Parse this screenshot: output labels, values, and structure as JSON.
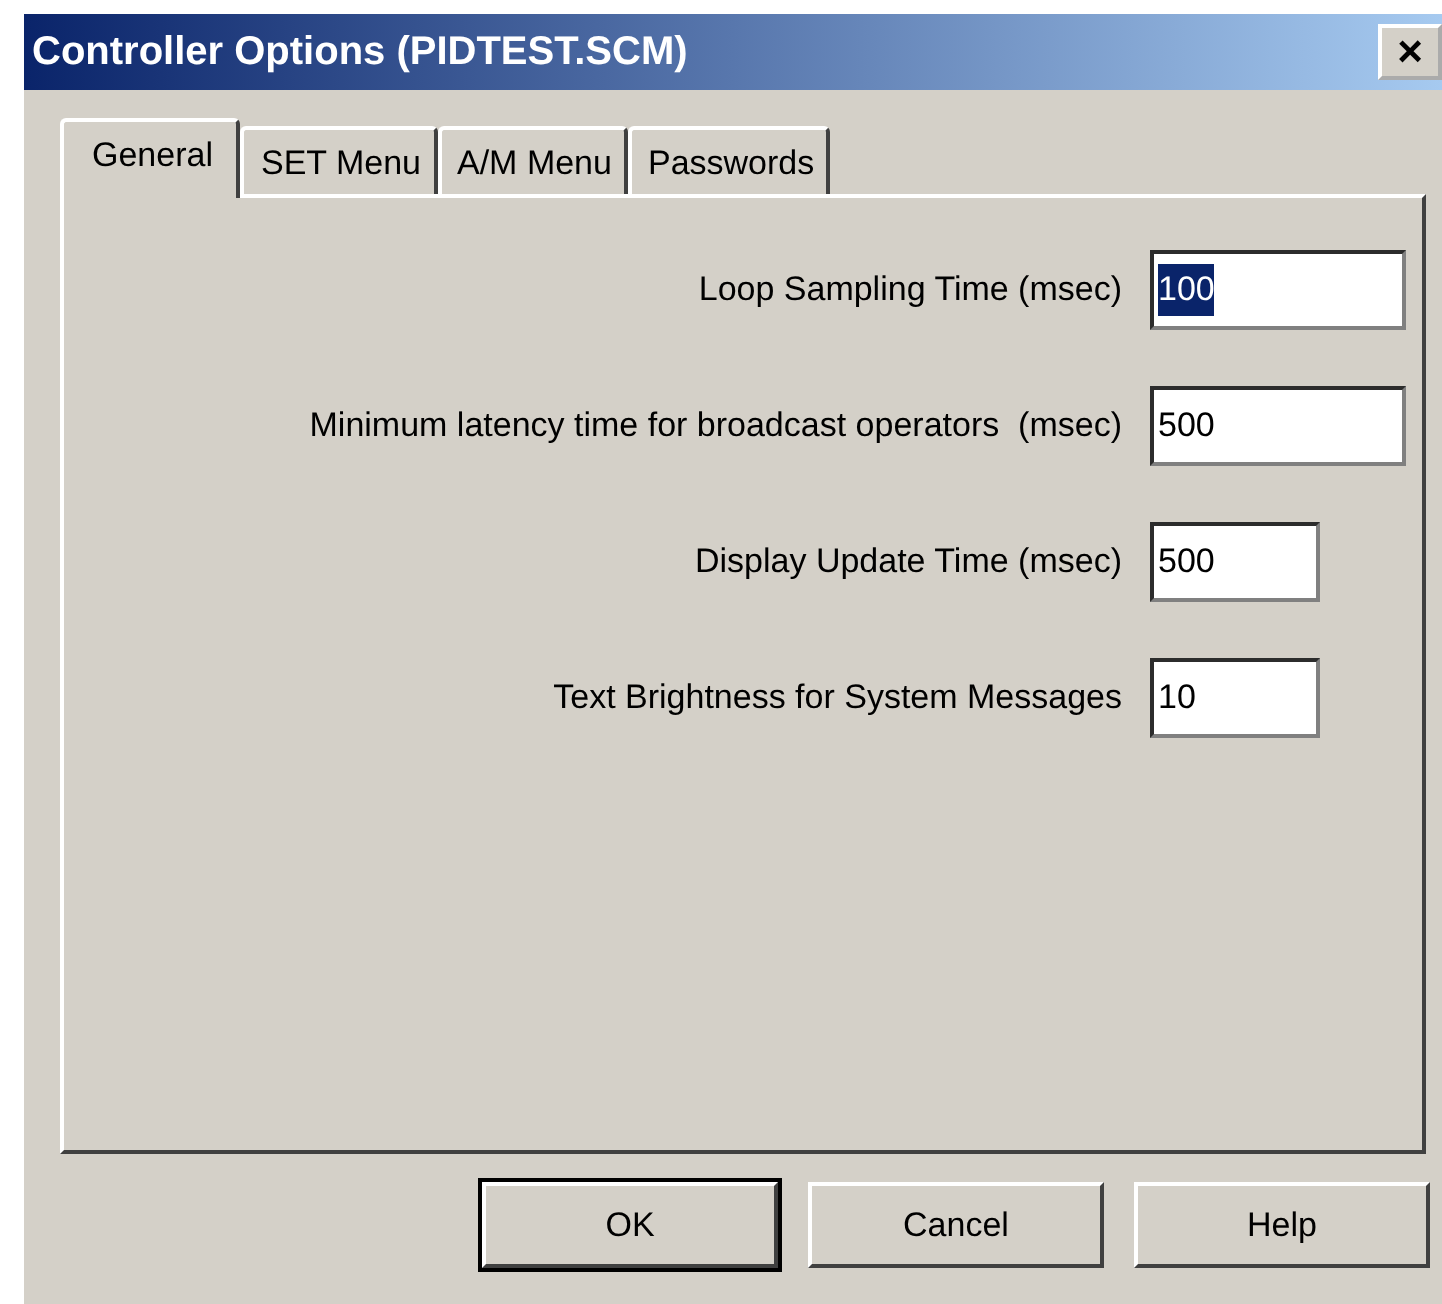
{
  "window": {
    "title": "Controller Options (PIDTEST.SCM)",
    "close_label": "×"
  },
  "tabs": [
    {
      "label": "General",
      "selected": true
    },
    {
      "label": "SET Menu",
      "selected": false
    },
    {
      "label": "A/M Menu",
      "selected": false
    },
    {
      "label": "Passwords",
      "selected": false
    }
  ],
  "fields": [
    {
      "label": "Loop Sampling Time (msec)",
      "value": "100",
      "kind": "wide",
      "text_selected": true
    },
    {
      "label": "Minimum latency time for broadcast operators  (msec)",
      "value": "500",
      "kind": "wide",
      "text_selected": false
    },
    {
      "label": "Display Update Time (msec)",
      "value": "500",
      "kind": "narrow",
      "text_selected": false
    },
    {
      "label": "Text Brightness for System Messages",
      "value": "10",
      "kind": "narrow",
      "text_selected": false
    }
  ],
  "buttons": [
    {
      "label": "OK",
      "default": true
    },
    {
      "label": "Cancel",
      "default": false
    },
    {
      "label": "Help",
      "default": false
    }
  ]
}
